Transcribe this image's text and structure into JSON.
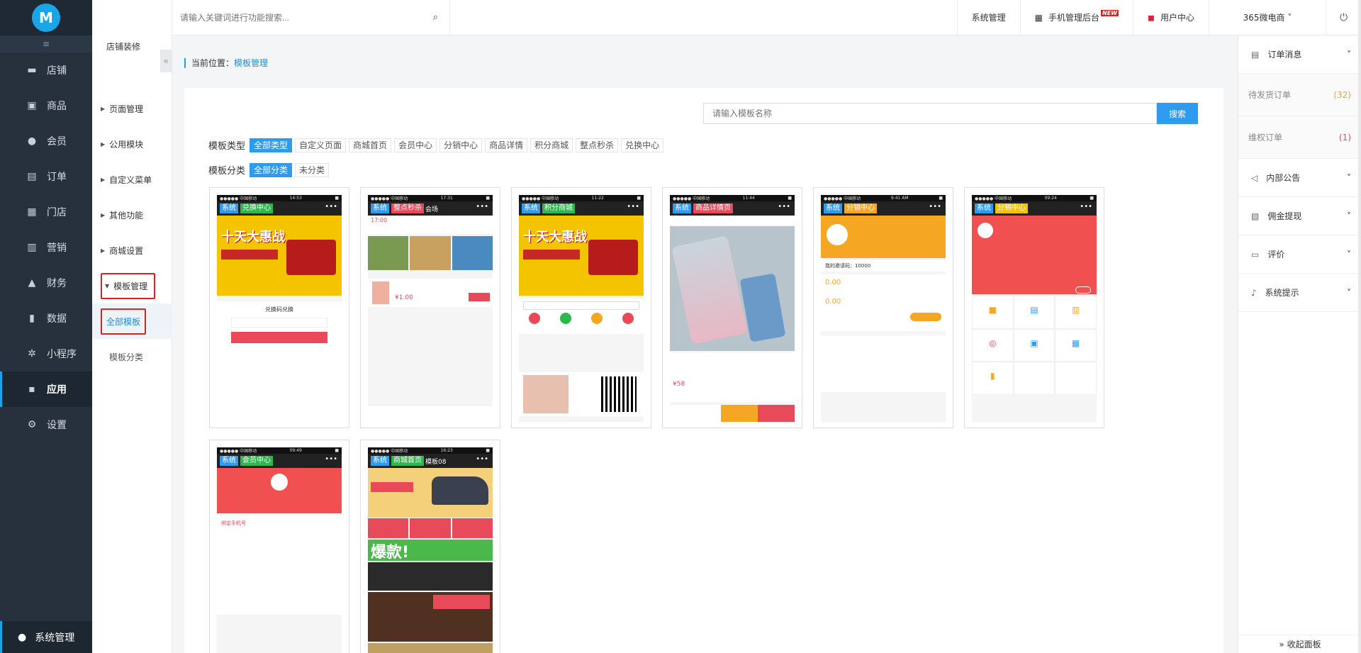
{
  "sidebar": {
    "logo": "M",
    "collapse_icon": "≡",
    "items": [
      {
        "label": "店铺",
        "icon": "shop-icon",
        "glyph": "▬"
      },
      {
        "label": "商品",
        "icon": "goods-icon",
        "glyph": "▣"
      },
      {
        "label": "会员",
        "icon": "member-icon",
        "glyph": "●"
      },
      {
        "label": "订单",
        "icon": "order-icon",
        "glyph": "▤"
      },
      {
        "label": "门店",
        "icon": "store-icon",
        "glyph": "▦"
      },
      {
        "label": "营销",
        "icon": "marketing-icon",
        "glyph": "▥"
      },
      {
        "label": "财务",
        "icon": "finance-icon",
        "glyph": "▲"
      },
      {
        "label": "数据",
        "icon": "data-icon",
        "glyph": "▮"
      },
      {
        "label": "小程序",
        "icon": "miniapp-icon",
        "glyph": "✲"
      },
      {
        "label": "应用",
        "icon": "apps-icon",
        "glyph": "▪"
      },
      {
        "label": "设置",
        "icon": "settings-icon",
        "glyph": "⚙"
      }
    ],
    "active_index": 9,
    "bottom_label": "系统管理"
  },
  "subsidebar": {
    "title": "店铺装修",
    "collapse": "«",
    "items": [
      "页面管理",
      "公用模块",
      "自定义菜单",
      "其他功能",
      "商城设置"
    ],
    "open_item": "模板管理",
    "children": [
      "全部模板",
      "模板分类"
    ]
  },
  "topbar": {
    "search_placeholder": "请输入关键词进行功能搜索...",
    "links": [
      {
        "label": "系统管理",
        "icon": ""
      },
      {
        "label": "手机管理后台",
        "icon": "qrcode-icon",
        "badge": "NEW"
      },
      {
        "label": "用户中心",
        "icon": "user-center-icon"
      }
    ],
    "shop_name": "365微电商 ˅"
  },
  "breadcrumb": {
    "prefix": "当前位置：",
    "current": "模板管理"
  },
  "main": {
    "search_placeholder": "请输入模板名称",
    "search_button": "搜索",
    "type_label": "模板类型",
    "types": [
      "全部类型",
      "自定义页面",
      "商城首页",
      "会员中心",
      "分销中心",
      "商品详情",
      "积分商城",
      "整点秒杀",
      "兑换中心"
    ],
    "category_label": "模板分类",
    "categories": [
      "全部分类",
      "未分类"
    ],
    "templates": [
      {
        "sys": "系统",
        "name": "兑换中心",
        "color": "#2cb84a",
        "time": "14:53",
        "banner": "十天大惠战"
      },
      {
        "sys": "系统",
        "name": "整点秒杀",
        "color": "#e84a5a",
        "time": "17:31",
        "suffix": "会场"
      },
      {
        "sys": "系统",
        "name": "积分商城",
        "color": "#2cb84a",
        "time": "11:22",
        "banner": "十天大惠战"
      },
      {
        "sys": "系统",
        "name": "商品详情页",
        "color": "#e84a5a",
        "time": "11:44"
      },
      {
        "sys": "系统",
        "name": "分销中心",
        "color": "#f5a623",
        "time": "9:41 AM"
      },
      {
        "sys": "系统",
        "name": "分销中心",
        "color": "#f5c400",
        "time": "09:24"
      },
      {
        "sys": "系统",
        "name": "会员中心",
        "color": "#2cb84a",
        "time": "09:49"
      },
      {
        "sys": "系统",
        "name": "商城首页",
        "color": "#2cb84a",
        "time": "16:23",
        "suffix": "模板08"
      }
    ]
  },
  "right_panel": {
    "order_msg": "订单消息",
    "pending_ship": {
      "label": "待发货订单",
      "count": "(32)"
    },
    "rights_order": {
      "label": "维权订单",
      "count": "(1)"
    },
    "notice": "内部公告",
    "commission": "佣金提现",
    "review": "评价",
    "system_tip": "系统提示",
    "collapse": "» 收起面板"
  }
}
